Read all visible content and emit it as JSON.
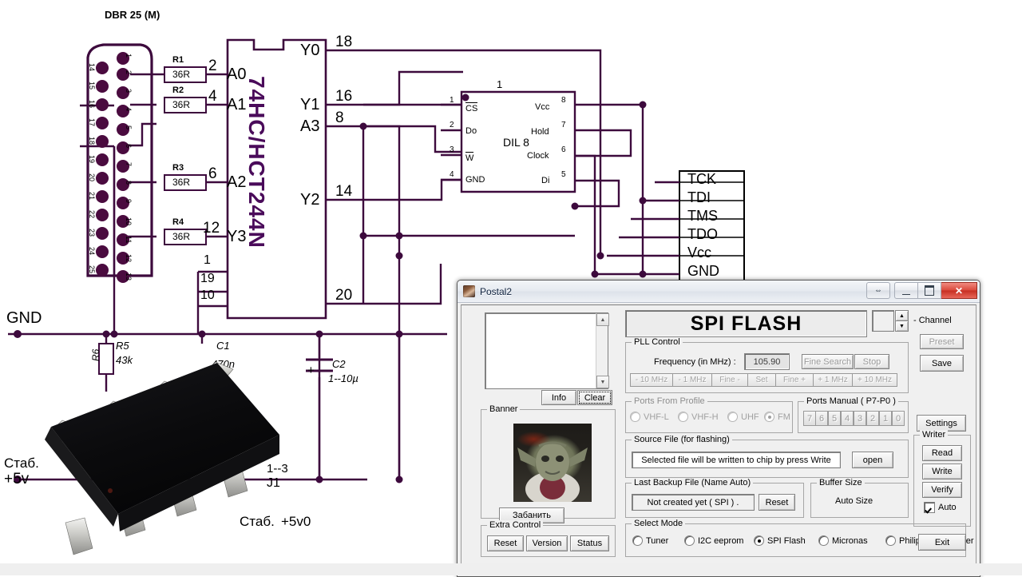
{
  "schematic": {
    "connector": {
      "title": "DBR 25 (M)",
      "pins_right": [
        "1",
        "2",
        "3",
        "4",
        "5",
        "6",
        "7",
        "8",
        "9",
        "10",
        "11",
        "12",
        "13"
      ],
      "pins_left": [
        "14",
        "15",
        "16",
        "17",
        "18",
        "19",
        "20",
        "21",
        "22",
        "23",
        "24",
        "25"
      ]
    },
    "resistors": [
      {
        "ref": "R1",
        "value": "36R"
      },
      {
        "ref": "R2",
        "value": "36R"
      },
      {
        "ref": "R3",
        "value": "36R"
      },
      {
        "ref": "R4",
        "value": "36R"
      },
      {
        "ref": "R5",
        "value": "43k"
      },
      {
        "ref": "R6",
        "value": ""
      }
    ],
    "capacitors": [
      {
        "ref": "C1",
        "value": "470n"
      },
      {
        "ref": "C2",
        "value": "1--10µ"
      }
    ],
    "ic_main": {
      "name": "74HC/HCT244N",
      "left_pins": [
        {
          "num": "2",
          "label": "A0"
        },
        {
          "num": "4",
          "label": "A1"
        },
        {
          "num": "6",
          "label": "A2"
        },
        {
          "num": "12",
          "label": "Y3"
        },
        {
          "num": "1",
          "label": ""
        },
        {
          "num": "19",
          "label": ""
        },
        {
          "num": "10",
          "label": ""
        }
      ],
      "right_pins": [
        {
          "num": "18",
          "label": "Y0"
        },
        {
          "num": "16",
          "label": "Y1"
        },
        {
          "num": "8",
          "label": "A3"
        },
        {
          "num": "14",
          "label": "Y2"
        },
        {
          "num": "20",
          "label": ""
        }
      ]
    },
    "ic_dil8": {
      "name": "DIL 8",
      "top_mark": "1",
      "left_pins": [
        {
          "num": "1",
          "label": "CS"
        },
        {
          "num": "2",
          "label": "Do"
        },
        {
          "num": "3",
          "label": "W"
        },
        {
          "num": "4",
          "label": "GND"
        }
      ],
      "right_pins": [
        {
          "num": "8",
          "label": "Vcc"
        },
        {
          "num": "7",
          "label": "Hold"
        },
        {
          "num": "6",
          "label": "Clock"
        },
        {
          "num": "5",
          "label": "Di"
        }
      ]
    },
    "jtag_header": [
      "TCK",
      "TDI",
      "TMS",
      "TDO",
      "Vcc",
      "GND"
    ],
    "net_labels": {
      "gnd": "GND",
      "stab_left": "Стаб.",
      "plus5v": "+5v",
      "stab_bottom": "Стаб.",
      "plus5v0": "+5v0",
      "j1": "J1",
      "j1_range": "1--3"
    },
    "wire_color": "#3d0a3d"
  },
  "dialog": {
    "title": "Postal2",
    "titlebar_buttons": {
      "resize": "⇔",
      "minimize": "minimize",
      "maximize": "maximize",
      "close": "✕"
    },
    "header_banner": "SPI FLASH",
    "channel": {
      "label": "- Channel",
      "value": ""
    },
    "log": {
      "value": "",
      "info_label": "Info",
      "clear_label": "Clear"
    },
    "banner": {
      "group_label": "Banner",
      "button_label": "Забанить"
    },
    "extra_control": {
      "group_label": "Extra Control",
      "buttons": [
        "Reset",
        "Version",
        "Status"
      ]
    },
    "pll": {
      "group_label": "PLL Control",
      "frequency_label": "Frequency (in MHz) :",
      "frequency_value": "105.90",
      "fine_search_label": "Fine Search",
      "stop_label": "Stop",
      "step_buttons": [
        "- 10 MHz",
        "- 1 MHz",
        "Fine -",
        "Set",
        "Fine +",
        "+ 1 MHz",
        "+ 10 MHz"
      ]
    },
    "ports_profile": {
      "group_label": "Ports From Profile",
      "options": [
        "VHF-L",
        "VHF-H",
        "UHF",
        "FM"
      ],
      "selected": "FM"
    },
    "ports_manual": {
      "group_label": "Ports Manual ( P7-P0 )",
      "digits": [
        "7",
        "6",
        "5",
        "4",
        "3",
        "2",
        "1",
        "0"
      ]
    },
    "source_file": {
      "group_label": "Source File (for flashing)",
      "value": "Selected file will be written to chip by press Write",
      "open_label": "open"
    },
    "last_backup": {
      "group_label": "Last Backup File (Name Auto)",
      "value": "Not created yet ( SPI ) .",
      "reset_label": "Reset"
    },
    "buffer_size": {
      "group_label": "Buffer Size",
      "value": "Auto Size"
    },
    "select_mode": {
      "group_label": "Select Mode",
      "options": [
        "Tuner",
        "I2C eeprom",
        "SPI Flash",
        "Micronas",
        "Philips",
        "Other"
      ],
      "selected": "SPI Flash"
    },
    "side_buttons": {
      "preset": "Preset",
      "save": "Save",
      "settings": "Settings"
    },
    "writer": {
      "group_label": "Writer",
      "read_label": "Read",
      "write_label": "Write",
      "verify_label": "Verify",
      "auto_label": "Auto",
      "auto_checked": true,
      "exit_label": "Exit"
    }
  }
}
